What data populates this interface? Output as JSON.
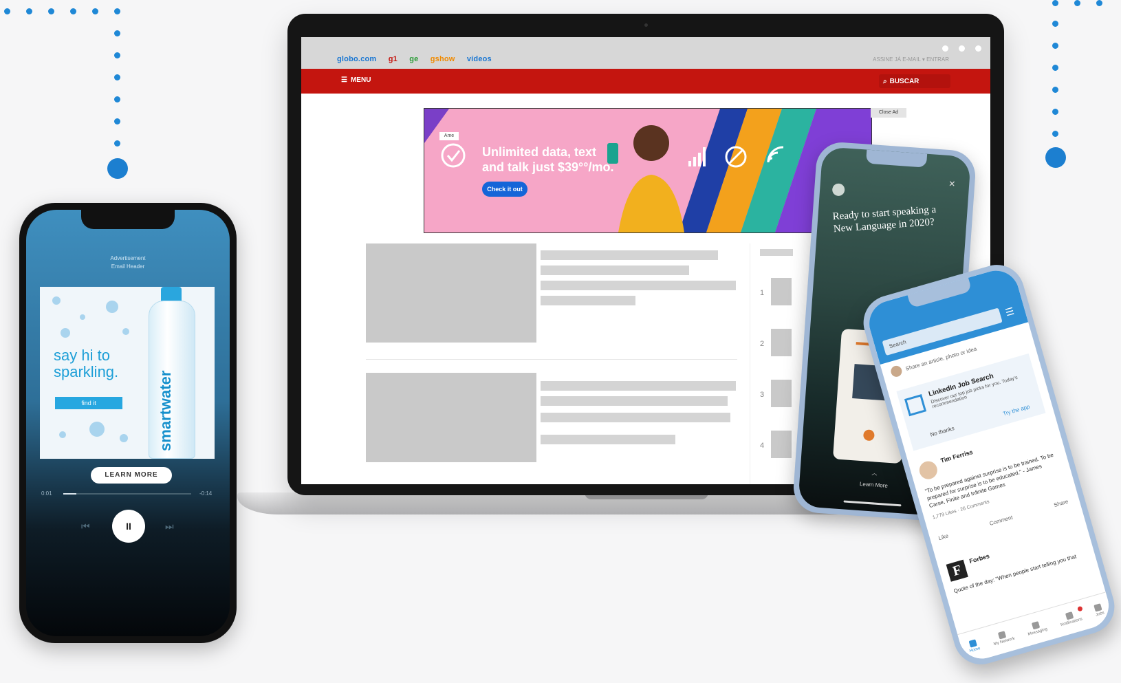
{
  "colors": {
    "accent_blue": "#1f88d6",
    "globo_red": "#c4150f",
    "ad_pink": "#f6a6c7",
    "linkedin_blue": "#2e8fd6"
  },
  "laptop": {
    "nav_links": [
      "globo.com",
      "g1",
      "ge",
      "gshow",
      "vídeos"
    ],
    "top_right": "ASSINE JÁ   E-MAIL ▾   ENTRAR",
    "menu_label": "MENU",
    "search_label": "BUSCAR",
    "ad": {
      "tag": "Ame",
      "headline": "Unlimited data, text and talk just $39°°/mo.",
      "cta": "Check it out",
      "close": "Close Ad"
    },
    "ranks": [
      "1",
      "2",
      "3",
      "4"
    ]
  },
  "phone_left": {
    "header_line1": "Advertisement",
    "header_line2": "Email Header",
    "tagline": "say hi to sparkling.",
    "find_button": "find it",
    "bottle_label": "smartwater",
    "learn_more": "LEARN MORE",
    "time_elapsed": "0:01",
    "time_remaining": "-0:14",
    "progress": 0.1,
    "pause_icon": "II",
    "prev_icon": "⏮",
    "next_icon": "⏭"
  },
  "phone_mid": {
    "story_text": "Ready to start speaking a New Language in 2020?",
    "learn_more": "Learn More"
  },
  "phone_right": {
    "search_placeholder": "Search",
    "share_prompt": "Share an article, photo or idea",
    "job_title": "LinkedIn Job Search",
    "job_sub": "Discover our top job picks for you. Today's recommendation",
    "no_thanks": "No thanks",
    "try_app": "Try the app",
    "post_author": "Tim Ferriss",
    "post_text": "\"To be prepared against surprise is to be trained. To be prepared for surprise is to be educated.\" - James Carse, Finite and Infinite Games",
    "post_meta": "1,779 Likes · 26 Comments",
    "actions": [
      "Like",
      "Comment",
      "Share"
    ],
    "company": "Forbes",
    "company_letter": "F",
    "quote": "Quote of the day: \"When people start telling you that",
    "tabs": [
      "Home",
      "My Network",
      "Messaging",
      "Notifications",
      "Jobs"
    ]
  }
}
